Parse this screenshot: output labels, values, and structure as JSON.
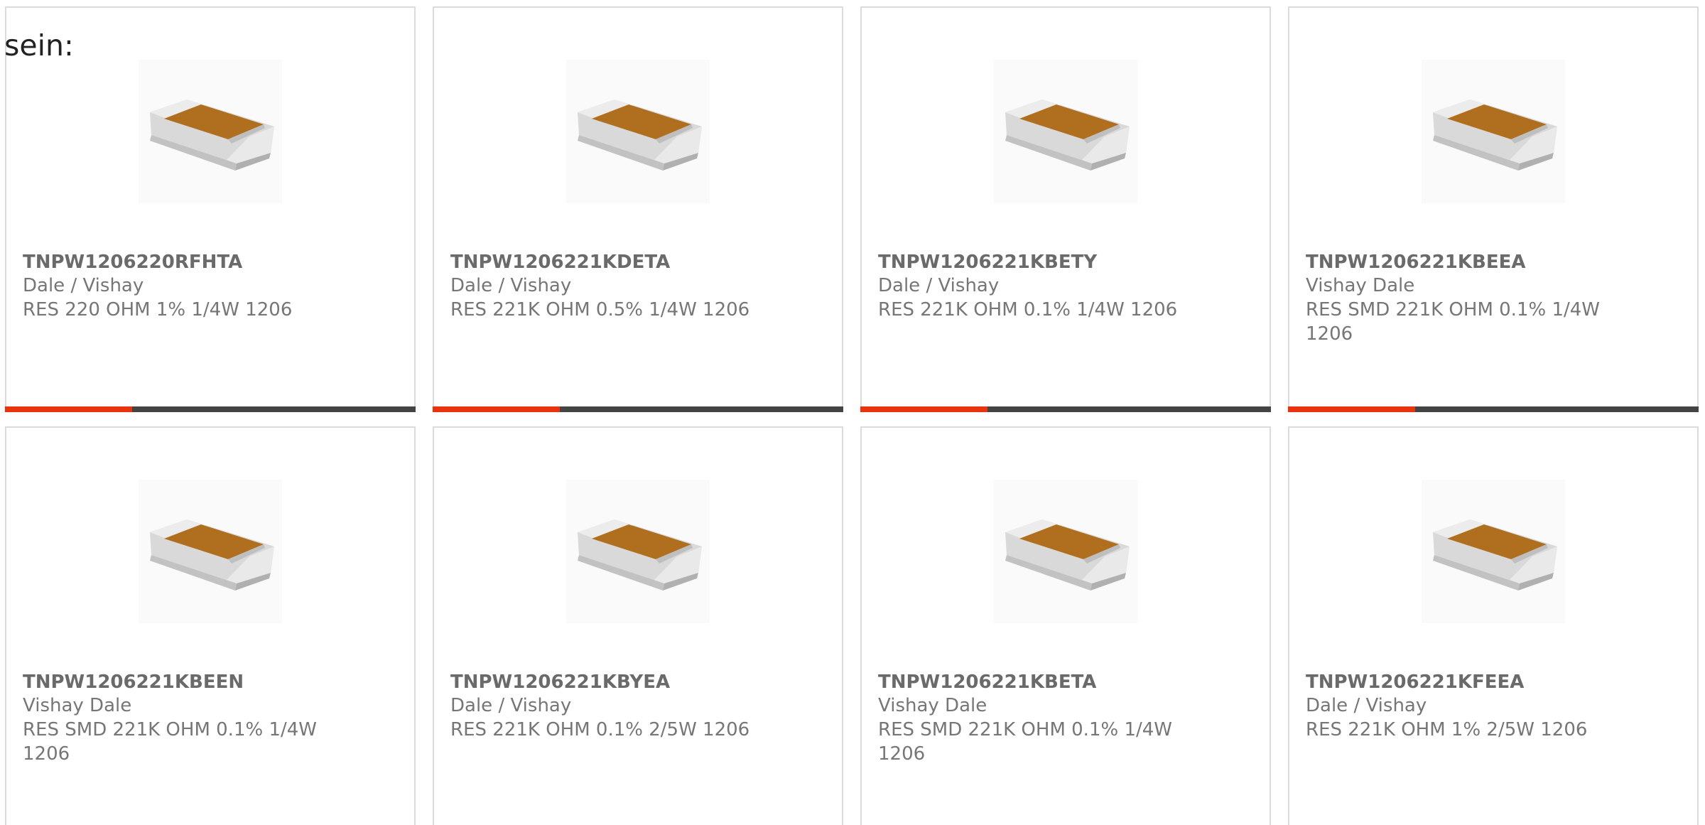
{
  "intro_text": "sein:",
  "colors": {
    "accent": "#e8330e",
    "bar_track": "#444444",
    "card_border": "#dcdcdc",
    "text": "#767676"
  },
  "rows": [
    {
      "cards": [
        {
          "part": "TNPW1206220RFHTA",
          "manufacturer": "Dale / Vishay",
          "description": "RES 220 OHM 1% 1/4W 1206",
          "image_icon": "smd-resistor-chip-image",
          "progress_pct": 31
        },
        {
          "part": "TNPW1206221KDETA",
          "manufacturer": "Dale / Vishay",
          "description": "RES 221K OHM 0.5% 1/4W 1206",
          "image_icon": "smd-resistor-chip-image",
          "progress_pct": 31
        },
        {
          "part": "TNPW1206221KBETY",
          "manufacturer": "Dale / Vishay",
          "description": "RES 221K OHM 0.1% 1/4W 1206",
          "image_icon": "smd-resistor-chip-image",
          "progress_pct": 31
        },
        {
          "part": "TNPW1206221KBEEA",
          "manufacturer": "Vishay Dale",
          "description": "RES SMD 221K OHM 0.1% 1/4W 1206",
          "image_icon": "smd-resistor-chip-image",
          "progress_pct": 31
        }
      ]
    },
    {
      "cards": [
        {
          "part": "TNPW1206221KBEEN",
          "manufacturer": "Vishay Dale",
          "description": "RES SMD 221K OHM 0.1% 1/4W 1206",
          "image_icon": "smd-resistor-chip-image",
          "progress_pct": null
        },
        {
          "part": "TNPW1206221KBYEA",
          "manufacturer": "Dale / Vishay",
          "description": "RES 221K OHM 0.1% 2/5W 1206",
          "image_icon": "smd-resistor-chip-image",
          "progress_pct": null
        },
        {
          "part": "TNPW1206221KBETA",
          "manufacturer": "Vishay Dale",
          "description": "RES SMD 221K OHM 0.1% 1/4W 1206",
          "image_icon": "smd-resistor-chip-image",
          "progress_pct": null
        },
        {
          "part": "TNPW1206221KFEEA",
          "manufacturer": "Dale / Vishay",
          "description": "RES 221K OHM 1% 2/5W 1206",
          "image_icon": "smd-resistor-chip-image",
          "progress_pct": null
        }
      ]
    }
  ]
}
